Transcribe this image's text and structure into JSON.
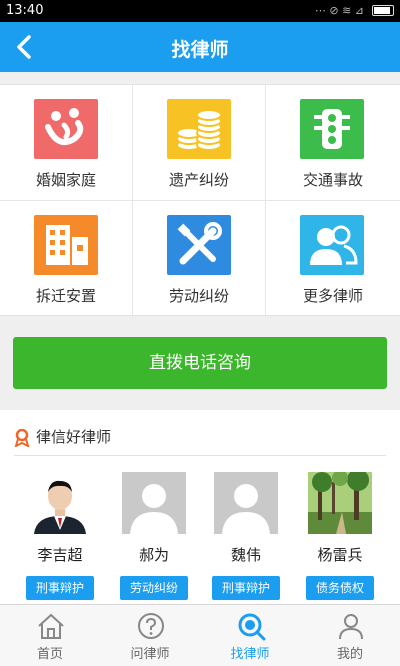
{
  "status": {
    "time": "13:40",
    "icons": "⋯ ⊘ ≋ ⊿"
  },
  "header": {
    "title": "找律师",
    "back_icon": "chevron-left-icon"
  },
  "categories": [
    {
      "label": "婚姻家庭",
      "color": "#f06a6a",
      "icon": "marriage-icon"
    },
    {
      "label": "遗产纠纷",
      "color": "#f7c223",
      "icon": "coins-icon"
    },
    {
      "label": "交通事故",
      "color": "#3cbc4a",
      "icon": "traffic-light-icon"
    },
    {
      "label": "拆迁安置",
      "color": "#f48a2a",
      "icon": "building-icon"
    },
    {
      "label": "劳动纠纷",
      "color": "#2f8be0",
      "icon": "tools-icon"
    },
    {
      "label": "更多律师",
      "color": "#2fb5e8",
      "icon": "users-icon"
    }
  ],
  "call_button": {
    "label": "直拨电话咨询"
  },
  "lawyers_section": {
    "title": "律信好律师"
  },
  "lawyers": [
    {
      "name": "李吉超",
      "tag": "刑事辩护",
      "photo": "portrait-photo"
    },
    {
      "name": "郝为",
      "tag": "劳动纠纷",
      "photo": "avatar-placeholder"
    },
    {
      "name": "魏伟",
      "tag": "刑事辩护",
      "photo": "avatar-placeholder"
    },
    {
      "name": "杨雷兵",
      "tag": "债务债权",
      "photo": "forest-photo"
    }
  ],
  "tabs": [
    {
      "label": "首页",
      "icon": "home-icon",
      "active": false
    },
    {
      "label": "问律师",
      "icon": "question-icon",
      "active": false
    },
    {
      "label": "找律师",
      "icon": "search-icon",
      "active": true
    },
    {
      "label": "我的",
      "icon": "user-icon",
      "active": false
    }
  ],
  "colors": {
    "primary": "#1b9ef0",
    "call_green": "#3cb72d"
  }
}
